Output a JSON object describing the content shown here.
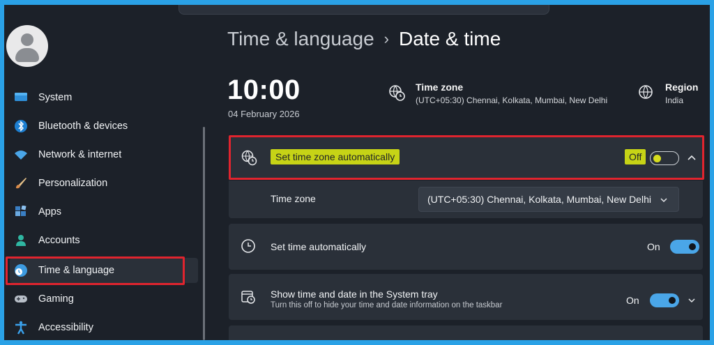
{
  "sidebar": {
    "items": [
      {
        "label": "System",
        "icon": "monitor-icon"
      },
      {
        "label": "Bluetooth & devices",
        "icon": "bluetooth-icon"
      },
      {
        "label": "Network & internet",
        "icon": "wifi-icon"
      },
      {
        "label": "Personalization",
        "icon": "brush-icon"
      },
      {
        "label": "Apps",
        "icon": "apps-icon"
      },
      {
        "label": "Accounts",
        "icon": "person-icon"
      },
      {
        "label": "Time & language",
        "icon": "globe-clock-icon",
        "active": true
      },
      {
        "label": "Gaming",
        "icon": "gamepad-icon"
      },
      {
        "label": "Accessibility",
        "icon": "accessibility-icon"
      }
    ]
  },
  "breadcrumb": {
    "parent": "Time & language",
    "separator": "›",
    "current": "Date & time"
  },
  "clock": {
    "time": "10:00",
    "date": "04 February 2026"
  },
  "summary": {
    "timezone_title": "Time zone",
    "timezone_value": "(UTC+05:30) Chennai, Kolkata, Mumbai, New Delhi",
    "region_title": "Region",
    "region_value": "India"
  },
  "settings": {
    "auto_timezone": {
      "label": "Set time zone automatically",
      "state": "Off"
    },
    "timezone_row": {
      "label": "Time zone",
      "value": "(UTC+05:30) Chennai, Kolkata, Mumbai, New Delhi"
    },
    "auto_time": {
      "label": "Set time automatically",
      "state": "On"
    },
    "systray": {
      "label": "Show time and date in the System tray",
      "description": "Turn this off to hide your time and date information on the taskbar",
      "state": "On"
    }
  },
  "colors": {
    "accent": "#4aa6e8",
    "highlight": "#c6d316",
    "annotation_red": "#e0242e",
    "border_blue": "#2aa1e6"
  }
}
